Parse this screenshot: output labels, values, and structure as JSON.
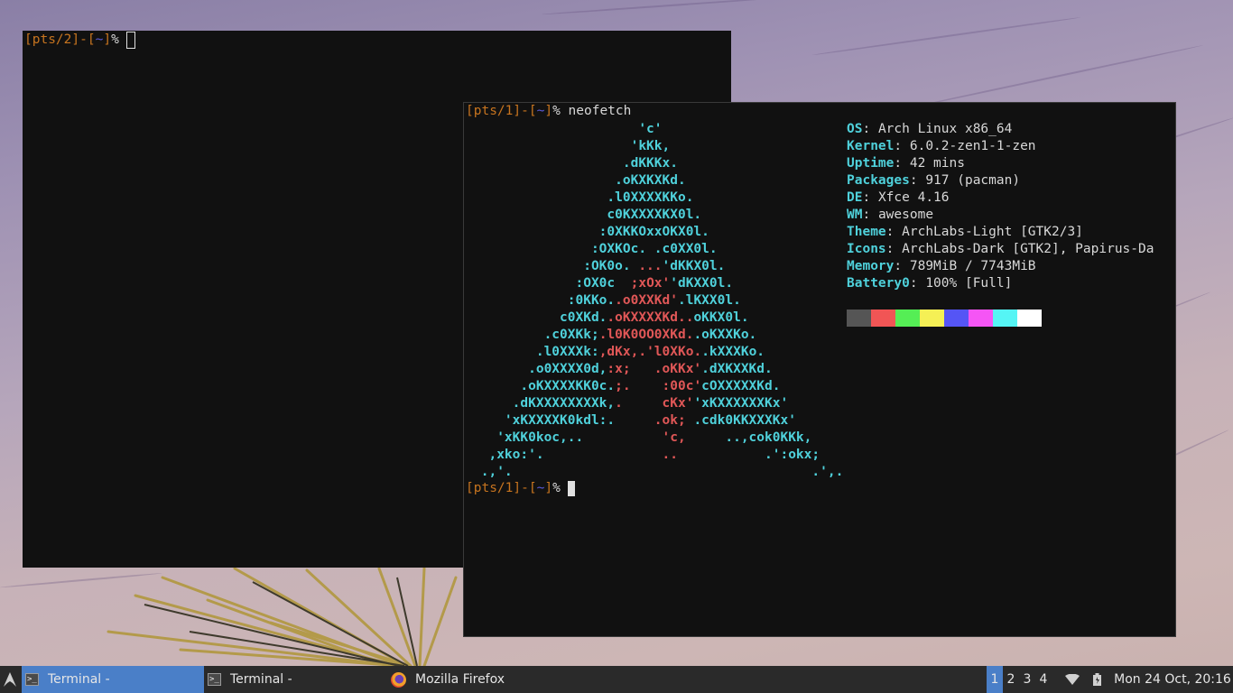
{
  "terminal_a": {
    "prompt": {
      "open": "[",
      "tty": "pts/2",
      "sep": "]-[",
      "dir": "~",
      "close": "]",
      "sigil": "%"
    }
  },
  "terminal_b": {
    "prompt": {
      "open": "[",
      "tty": "pts/1",
      "sep": "]-[",
      "dir": "~",
      "close": "]",
      "sigil": "%"
    },
    "command": "neofetch",
    "logo_lines": [
      [
        [
          "cy",
          "                     'c'"
        ]
      ],
      [
        [
          "cy",
          "                    'kKk,"
        ]
      ],
      [
        [
          "cy",
          "                   .dKKKx."
        ]
      ],
      [
        [
          "cy",
          "                  .oKXKXKd."
        ]
      ],
      [
        [
          "cy",
          "                 .l0XXXXKKo."
        ]
      ],
      [
        [
          "cy",
          "                 c0KXXXXKX0l."
        ]
      ],
      [
        [
          "cy",
          "                :0XKKOxxOKX0l."
        ]
      ],
      [
        [
          "cy",
          "               :OXKOc. .c0XX0l."
        ]
      ],
      [
        [
          "cy",
          "              :OK0o. "
        ],
        [
          "rd",
          "..."
        ],
        [
          "cy",
          "'dKKX0l."
        ]
      ],
      [
        [
          "cy",
          "             :OX0c  "
        ],
        [
          "rd",
          ";xOx'"
        ],
        [
          "cy",
          "'dKXX0l."
        ]
      ],
      [
        [
          "cy",
          "            :0KKo."
        ],
        [
          "rd",
          ".o0XXKd'"
        ],
        [
          "cy",
          ".lKXX0l."
        ]
      ],
      [
        [
          "cy",
          "           c0XKd."
        ],
        [
          "rd",
          ".oKXXXXKd.."
        ],
        [
          "cy",
          "oKKX0l."
        ]
      ],
      [
        [
          "cy",
          "         .c0XKk;"
        ],
        [
          "rd",
          ".l0K0OO0XKd."
        ],
        [
          "cy",
          ".oKXXKo."
        ]
      ],
      [
        [
          "cy",
          "        .l0XXXk:"
        ],
        [
          "rd",
          ",dKx,.'l0XKo."
        ],
        [
          "cy",
          ".kXXXKo."
        ]
      ],
      [
        [
          "cy",
          "       .o0XXXX0d,"
        ],
        [
          "rd",
          ":x;   .oKKx'"
        ],
        [
          "cy",
          ".dXKXXKd."
        ]
      ],
      [
        [
          "cy",
          "      .oKXXXXKK0c."
        ],
        [
          "rd",
          ";.    :00c'"
        ],
        [
          "cy",
          "cOXXXXXKd."
        ]
      ],
      [
        [
          "cy",
          "     .dKXXXXXXXXk,"
        ],
        [
          "rd",
          ".     cKx'"
        ],
        [
          "cy",
          "'xKXXXXXXKx'"
        ]
      ],
      [
        [
          "cy",
          "    'xKXXXXK0kdl:."
        ],
        [
          "rd",
          "     .ok; "
        ],
        [
          "cy",
          ".cdk0KKXXXKx'"
        ]
      ],
      [
        [
          "cy",
          "   'xKK0koc,..     "
        ],
        [
          "rd",
          "     'c,"
        ],
        [
          "cy",
          "     ..,cok0KKk,"
        ]
      ],
      [
        [
          "cy",
          "  ,xko:'.          "
        ],
        [
          "rd",
          "     .."
        ],
        [
          "cy",
          "           .':okx;"
        ]
      ],
      [
        [
          "cy",
          " .,'.                                      .',."
        ]
      ]
    ],
    "info": [
      {
        "key": "OS",
        "value": "Arch Linux x86_64"
      },
      {
        "key": "Kernel",
        "value": "6.0.2-zen1-1-zen"
      },
      {
        "key": "Uptime",
        "value": "42 mins"
      },
      {
        "key": "Packages",
        "value": "917 (pacman)"
      },
      {
        "key": "DE",
        "value": "Xfce 4.16"
      },
      {
        "key": "WM",
        "value": "awesome"
      },
      {
        "key": "Theme",
        "value": "ArchLabs-Light [GTK2/3]"
      },
      {
        "key": "Icons",
        "value": "ArchLabs-Dark [GTK2], Papirus-Da"
      },
      {
        "key": "Memory",
        "value": "789MiB / 7743MiB"
      },
      {
        "key": "Battery0",
        "value": "100% [Full]"
      }
    ],
    "palette": [
      "#555555",
      "#f15555",
      "#55ee55",
      "#f5f055",
      "#5555f5",
      "#f555f5",
      "#55f5f5",
      "#ffffff"
    ]
  },
  "taskbar": {
    "launcher_icon": "arch-icon",
    "tasks": [
      {
        "label": "Terminal -",
        "icon": "terminal-icon",
        "active": true
      },
      {
        "label": "Terminal -",
        "icon": "terminal-icon",
        "active": false
      },
      {
        "label": "Mozilla Firefox",
        "icon": "firefox-icon",
        "active": false
      }
    ],
    "workspaces": [
      "1",
      "2",
      "3",
      "4"
    ],
    "active_workspace": "1",
    "clock": "Mon 24 Oct, 20:16"
  }
}
